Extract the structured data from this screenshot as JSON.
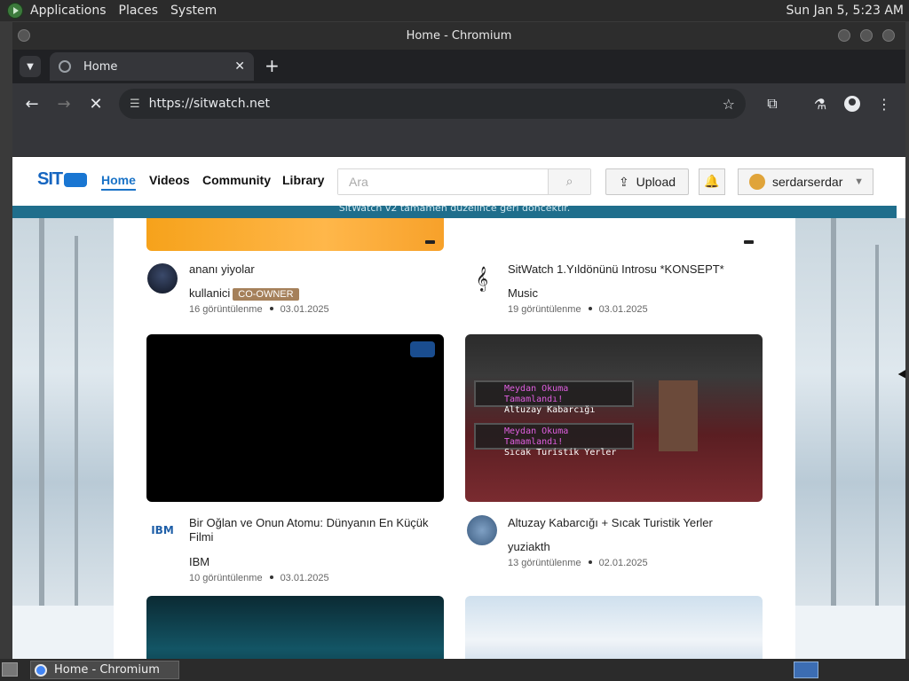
{
  "desktop": {
    "menu": [
      "Applications",
      "Places",
      "System"
    ],
    "clock": "Sun Jan  5,  5:23 AM"
  },
  "window": {
    "title": "Home - Chromium"
  },
  "browser": {
    "tab_title": "Home",
    "url": "https://sitwatch.net"
  },
  "site": {
    "logo": "SIT",
    "nav": [
      "Home",
      "Videos",
      "Community",
      "Library"
    ],
    "search_placeholder": "Ara",
    "upload_label": "Upload",
    "username": "serdarserdar",
    "announcement": "SitWatch v2 tamamen düzelince geri döncektir."
  },
  "videos": [
    {
      "title": "ananı yiyolar",
      "author": "kullanici",
      "badge": "CO-OWNER",
      "views": "16 görüntülenme",
      "date": "03.01.2025"
    },
    {
      "title": "SitWatch 1.Yıldönünü Introsu *KONSEPT*",
      "author": "Music",
      "views": "19 görüntülenme",
      "date": "03.01.2025"
    },
    {
      "title": "Bir Oğlan ve Onun Atomu: Dünyanın En Küçük Filmi",
      "author": "IBM",
      "author_avatar": "IBM",
      "views": "10 görüntülenme",
      "date": "03.01.2025"
    },
    {
      "title": "Altuzay Kabarcığı + Sıcak Turistik Yerler",
      "author": "yuziakth",
      "views": "13 görüntülenme",
      "date": "02.01.2025",
      "thumb_text": {
        "line1a": "Meydan Okuma Tamamlandı!",
        "line1b": "Altuzay Kabarcığı",
        "line2a": "Meydan Okuma Tamamlandı!",
        "line2b": "Sıcak Turistik Yerler"
      }
    }
  ],
  "taskbar": {
    "item": "Home - Chromium"
  },
  "colors": {
    "accent": "#1a73c7",
    "announce_bar": "#1f6e8c",
    "badge": "#a5805a"
  }
}
